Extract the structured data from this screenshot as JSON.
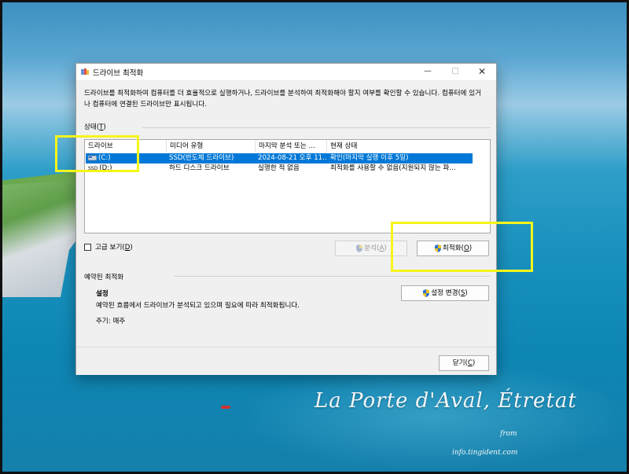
{
  "window": {
    "title": "드라이브 최적화",
    "intro": "드라이브를 최적화하여 컴퓨터를 더 효율적으로 실행하거나, 드라이브를 분석하여 최적화해야 할지 여부를 확인할 수 있습니다. 컴퓨터에 있거나 컴퓨터에 연결된 드라이브만 표시됩니다."
  },
  "status": {
    "label": "상태(",
    "key": "T",
    "label_end": ")"
  },
  "table": {
    "columns": [
      "드라이브",
      "미디어 유형",
      "마지막 분석 또는 ...",
      "현재 상태"
    ],
    "rows": [
      {
        "drive": "(C:)",
        "media": "SSD(반도체 드라이브)",
        "last": "2024-08-21 오후 11...",
        "status": "확인(마지막 실행 이후 5일)",
        "selected": true
      },
      {
        "drive": "(D:)",
        "media": "하드 디스크 드라이브",
        "last": "실행한 적 없음",
        "status": "최적화를 사용할 수 없음(지원되지 않는 파...",
        "selected": false
      }
    ],
    "ssd_tag": "SSD"
  },
  "advanced": {
    "label": "고급 보기(",
    "key": "D",
    "label_end": ")"
  },
  "buttons": {
    "analyze": {
      "label": "분석(",
      "key": "A",
      "end": ")"
    },
    "optimize": {
      "label": "최적화(",
      "key": "O",
      "end": ")"
    },
    "change": {
      "label": "설정 변경(",
      "key": "S",
      "end": ")"
    },
    "close": {
      "label": "닫기(",
      "key": "C",
      "end": ")"
    }
  },
  "schedule": {
    "section": "예약된 최적화",
    "title": "설정",
    "description": "예약된 흐름에서 드라이브가 분석되고 있으며 필요에 따라 최적화됩니다.",
    "frequency": "주기: 매주"
  },
  "desktop": {
    "caption": "La Porte d'Aval, Étretat",
    "from": "from",
    "site": "info.tingident.com"
  },
  "colors": {
    "accent": "#0078d7",
    "highlight_box": "#f5f51a",
    "shield_blue": "#2a6fd6",
    "shield_yellow": "#f2c21b"
  },
  "icons": {
    "title": "defrag-app-icon",
    "drive": "drive-icon",
    "shield": "uac-shield-icon"
  }
}
